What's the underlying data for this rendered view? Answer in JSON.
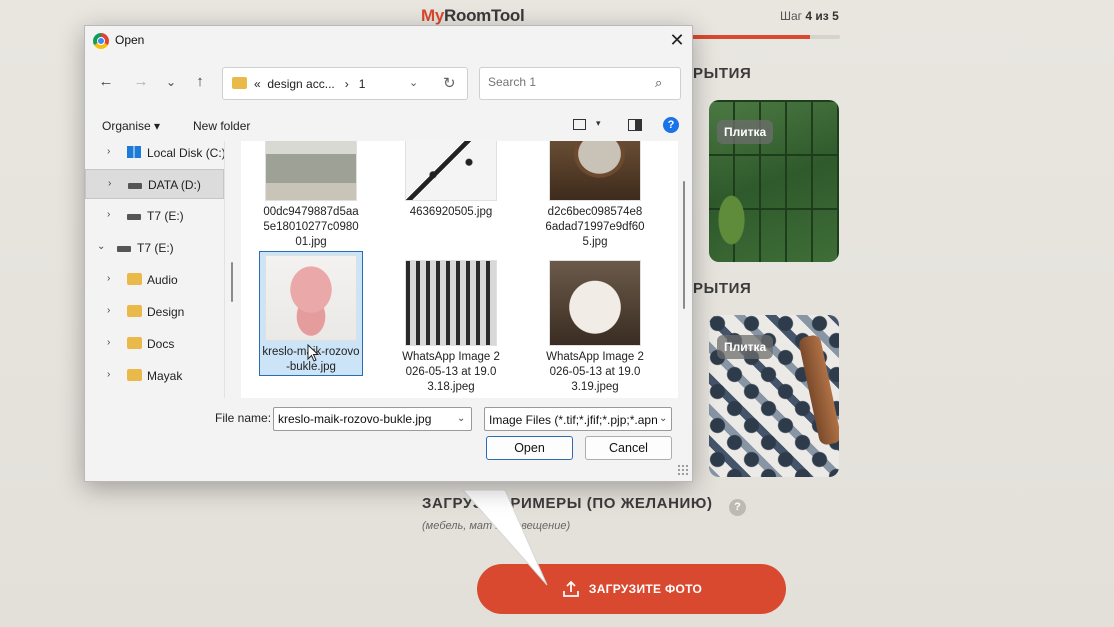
{
  "site": {
    "logo_my": "My",
    "logo_rest": "RoomTool",
    "step_prefix": "Шаг",
    "step_value": "4 из 5",
    "progress": 0.8,
    "section1": "РЫТИЯ",
    "section2": "РЫТИЯ",
    "tile_badge_1": "Плитка",
    "tile_badge_2": "Плитка",
    "upload_heading": "ЗАГРУЗИ  ПРИМЕРЫ (ПО ЖЕЛАНИЮ)",
    "help": "?",
    "upload_sub": "(мебель, мат      ы, освещение)",
    "upload_button": "ЗАГРУЗИТЕ ФОТО",
    "accent": "#d9492f"
  },
  "dialog": {
    "title": "Open",
    "close": "✕",
    "nav": {
      "back": "←",
      "forward": "→",
      "recent": "⌄",
      "up": "↑"
    },
    "address": {
      "prefix": "«",
      "crumb1": "design acc...",
      "sep": "›",
      "crumb2": "1",
      "dropdown": "⌄",
      "refresh": "↻"
    },
    "search_placeholder": "Search 1",
    "search_icon": "⌕",
    "toolbar": {
      "organise": "Organise ▾",
      "new_folder": "New folder",
      "view_dd": "▾",
      "help": "?"
    },
    "tree": [
      {
        "label": "Local Disk (C:)",
        "icon": "windows-drive",
        "chevron": "›",
        "indent": 1
      },
      {
        "label": "DATA (D:)",
        "icon": "drive",
        "chevron": "›",
        "indent": 1,
        "selected": true
      },
      {
        "label": "T7 (E:)",
        "icon": "drive",
        "chevron": "›",
        "indent": 1
      },
      {
        "label": "T7 (E:)",
        "icon": "drive",
        "chevron": "⌄",
        "indent": 0
      },
      {
        "label": "Audio",
        "icon": "folder",
        "chevron": "›",
        "indent": 1
      },
      {
        "label": "Design",
        "icon": "folder",
        "chevron": "›",
        "indent": 1
      },
      {
        "label": "Docs",
        "icon": "folder",
        "chevron": "›",
        "indent": 1
      },
      {
        "label": "Mayak",
        "icon": "folder",
        "chevron": "›",
        "indent": 1
      }
    ],
    "files": [
      {
        "name": "00dc9479887d5aa5e18010277c098001.jpg",
        "thumb": "grey-sofa"
      },
      {
        "name": "4636920505.jpg",
        "thumb": "black-chandelier"
      },
      {
        "name": "d2c6bec098574e86adad71997e9df605.jpg",
        "thumb": "coffee-table"
      },
      {
        "name": "kreslo-maik-rozovo-bukle.jpg",
        "thumb": "pink-armchair",
        "selected": true
      },
      {
        "name": "WhatsApp Image 2026-05-13 at 19.03.18.jpeg",
        "thumb": "plaid-armchair"
      },
      {
        "name": "WhatsApp Image 2026-05-13 at 19.03.19.jpeg",
        "thumb": "white-armchair"
      }
    ],
    "file_name_label": "File name:",
    "file_name_value": "kreslo-maik-rozovo-bukle.jpg",
    "file_type_value": "Image Files (*.tif;*.jfif;*.pjp;*.apng",
    "open_button": "Open",
    "cancel_button": "Cancel"
  }
}
